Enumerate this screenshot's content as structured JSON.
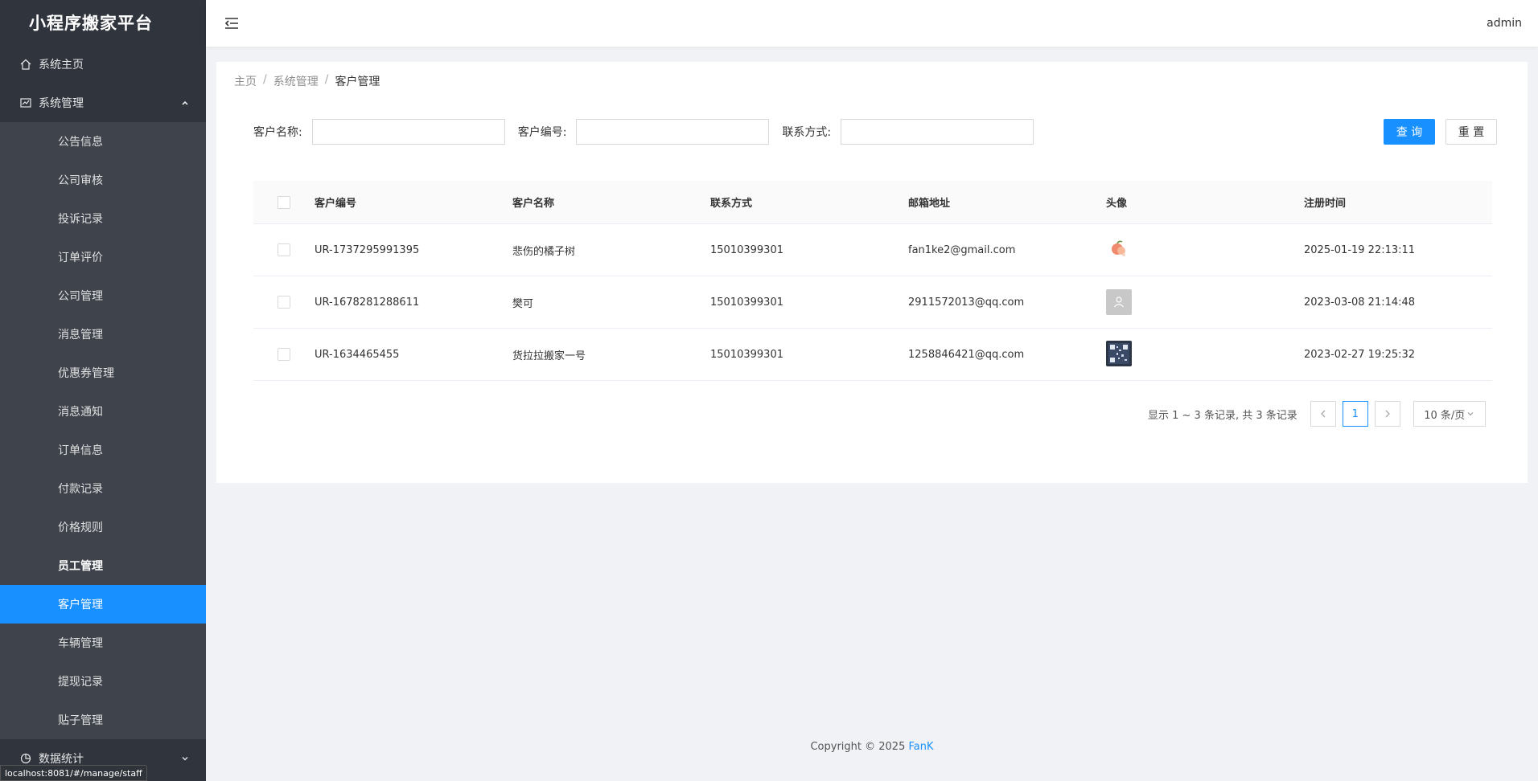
{
  "app": {
    "title": "小程序搬家平台",
    "user": "admin"
  },
  "sidebar": {
    "home": "系统主页",
    "system": {
      "label": "系统管理",
      "items": [
        {
          "label": "公告信息"
        },
        {
          "label": "公司审核"
        },
        {
          "label": "投诉记录"
        },
        {
          "label": "订单评价"
        },
        {
          "label": "公司管理"
        },
        {
          "label": "消息管理"
        },
        {
          "label": "优惠券管理"
        },
        {
          "label": "消息通知"
        },
        {
          "label": "订单信息"
        },
        {
          "label": "付款记录"
        },
        {
          "label": "价格规则"
        },
        {
          "label": "员工管理"
        },
        {
          "label": "客户管理"
        },
        {
          "label": "车辆管理"
        },
        {
          "label": "提现记录"
        },
        {
          "label": "贴子管理"
        }
      ]
    },
    "stats": "数据统计"
  },
  "breadcrumb": {
    "home": "主页",
    "sep": "/",
    "parent": "系统管理",
    "current": "客户管理"
  },
  "filters": {
    "name_label": "客户名称:",
    "code_label": "客户编号:",
    "contact_label": "联系方式:",
    "name_value": "",
    "code_value": "",
    "contact_value": ""
  },
  "buttons": {
    "search": "查 询",
    "reset": "重 置"
  },
  "table": {
    "columns": [
      "客户编号",
      "客户名称",
      "联系方式",
      "邮箱地址",
      "头像",
      "注册时间"
    ],
    "rows": [
      {
        "code": "UR-1737295991395",
        "name": "悲伤的橘子树",
        "phone": "15010399301",
        "email": "fan1ke2@gmail.com",
        "avatar": "peach-avatar",
        "time": "2025-01-19 22:13:11"
      },
      {
        "code": "UR-1678281288611",
        "name": "樊可",
        "phone": "15010399301",
        "email": "2911572013@qq.com",
        "avatar": "default-user-avatar",
        "time": "2023-03-08 21:14:48"
      },
      {
        "code": "UR-1634465455",
        "name": "货拉拉搬家一号",
        "phone": "15010399301",
        "email": "1258846421@qq.com",
        "avatar": "qr-avatar",
        "time": "2023-02-27 19:25:32"
      }
    ]
  },
  "pagination": {
    "summary": "显示 1 ~ 3 条记录, 共 3 条记录",
    "current_page": "1",
    "page_size": "10 条/页"
  },
  "footer": {
    "text": "Copyright © 2025 ",
    "brand": "FanK"
  },
  "statusbar": {
    "url": "localhost:8081/#/manage/staff"
  },
  "colors": {
    "sidebar_bg": "#30343d",
    "submenu_bg": "#3f434c",
    "primary": "#1890ff"
  }
}
